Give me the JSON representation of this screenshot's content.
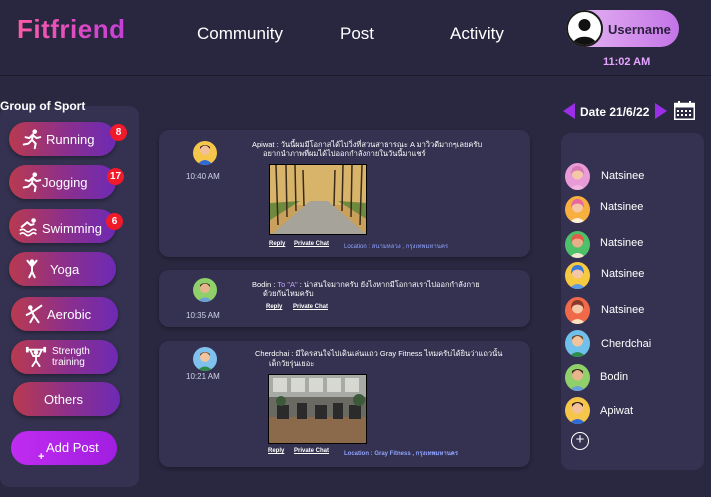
{
  "app": {
    "logo": "Fitfriend"
  },
  "nav": {
    "community": "Community",
    "post": "Post",
    "activity": "Activity"
  },
  "user": {
    "name": "Username",
    "time": "11:02 AM"
  },
  "sidebar": {
    "title": "Group of Sport",
    "sports": [
      {
        "label": "Running",
        "badge": "8",
        "icon": "running-icon"
      },
      {
        "label": "Jogging",
        "badge": "17",
        "icon": "jogging-icon"
      },
      {
        "label": "Swimming",
        "badge": "6",
        "icon": "swimming-icon"
      },
      {
        "label": "Yoga",
        "icon": "yoga-icon"
      },
      {
        "label": "Aerobic",
        "icon": "aerobic-icon"
      },
      {
        "label": "Strength",
        "label2": "training",
        "icon": "strength-icon"
      },
      {
        "label": "Others"
      }
    ],
    "add_post": "Add Post",
    "add_post_plus": "+"
  },
  "posts": [
    {
      "time": "10:40 AM",
      "author": "Apiwat",
      "text_line1": "Apiwat : วันนี้ผมมีโอกาสได้ไปวิ่งที่สวนสาธารณะ A มาวิวดีมากๆเลยครับ",
      "text_line2": "อยากนำภาพที่ผมได้ไปออกกำลังกายในวันนี้มาแชร์",
      "reply": "Reply",
      "private_chat": "Private Chat",
      "location": "Location : สนามหลวง , กรุงเทพมหานคร"
    },
    {
      "time": "10:35 AM",
      "author": "Bodin",
      "to": "To \"A\"",
      "text_line1_rest": ": น่าสนใจมากครับ ยังไงหากมีโอกาสเราไปออกกำลังกาย",
      "text_line2": "ด้วยกันไหมครับ",
      "reply": "Reply",
      "private_chat": "Private Chat"
    },
    {
      "time": "10:21 AM",
      "author": "Cherdchai",
      "text_line1": "Cherdchai : มีใครสนใจไปเดินเล่นแถว Gray Fitness ไหมครับได้ยินว่าแถวนั้น",
      "text_line2": "เด็กวัยรุ่นเยอะ",
      "reply": "Reply",
      "private_chat": "Private Chat",
      "location": "Location : Gray Fitness , กรุงเทพมหานคร"
    }
  ],
  "activity": {
    "date": "Date 21/6/22",
    "members": [
      {
        "name": "Natsinee"
      },
      {
        "name": "Natsinee"
      },
      {
        "name": "Natsinee"
      },
      {
        "name": "Natsinee"
      },
      {
        "name": "Natsinee"
      },
      {
        "name": "Cherdchai"
      },
      {
        "name": "Bodin"
      },
      {
        "name": "Apiwat"
      }
    ],
    "add_member": "+"
  },
  "colors": {
    "background": "#2a2840",
    "panel": "#343250",
    "accent": "#9b2fe8",
    "logo": "#e94aa6",
    "badge": "#f01a2a"
  }
}
